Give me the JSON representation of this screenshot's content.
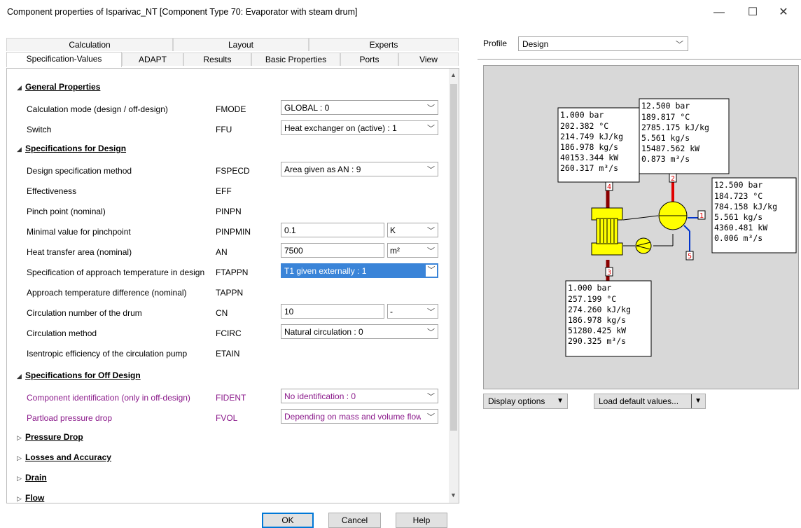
{
  "window": {
    "title": "Component properties of Isparivac_NT   [Component Type 70: Evaporator with steam drum]",
    "minimize": "—",
    "maximize": "☐",
    "close": "✕"
  },
  "tabs_row1": [
    "Calculation",
    "Layout",
    "Experts"
  ],
  "tabs_row2": [
    "Specification-Values",
    "ADAPT",
    "Results",
    "Basic Properties",
    "Ports",
    "View"
  ],
  "sections": {
    "general": "General Properties",
    "design": "Specifications for Design",
    "offdesign": "Specifications for Off Design",
    "pressure_drop": "Pressure Drop",
    "losses": "Losses and Accuracy",
    "drain": "Drain",
    "flow": "Flow"
  },
  "rows": [
    {
      "label": "Calculation mode (design / off-design)",
      "code": "FMODE",
      "value": "GLOBAL : 0"
    },
    {
      "label": "Switch",
      "code": "FFU",
      "value": "Heat exchanger on (active) : 1"
    },
    {
      "label": "Design specification method",
      "code": "FSPECD",
      "value": "Area given as AN : 9"
    },
    {
      "label": "Effectiveness",
      "code": "EFF",
      "value": ""
    },
    {
      "label": "Pinch point (nominal)",
      "code": "PINPN",
      "value": ""
    },
    {
      "label": "Minimal value for pinchpoint",
      "code": "PINPMIN",
      "value": "0.1",
      "unit": "K"
    },
    {
      "label": "Heat transfer area (nominal)",
      "code": "AN",
      "value": "7500",
      "unit": "m²"
    },
    {
      "label": "Specification of approach temperature in design",
      "code": "FTAPPN",
      "value": "T1 given externally : 1"
    },
    {
      "label": "Approach temperature difference (nominal)",
      "code": "TAPPN",
      "value": ""
    },
    {
      "label": "Circulation number of the drum",
      "code": "CN",
      "value": "10",
      "unit": "-"
    },
    {
      "label": "Circulation method",
      "code": "FCIRC",
      "value": "Natural circulation : 0"
    },
    {
      "label": "Isentropic efficiency of the circulation pump",
      "code": "ETAIN",
      "value": ""
    },
    {
      "label": "Component identification (only in off-design)",
      "code": "FIDENT",
      "value": "No identification : 0"
    },
    {
      "label": "Partload pressure drop",
      "code": "FVOL",
      "value": "Depending on mass and volume flow"
    }
  ],
  "buttons": {
    "ok": "OK",
    "cancel": "Cancel",
    "help": "Help"
  },
  "profile": {
    "label": "Profile",
    "value": "Design"
  },
  "bottom": {
    "display_options": "Display options",
    "load_defaults": "Load default values..."
  },
  "diagram": {
    "ports": [
      "1",
      "2",
      "3",
      "4",
      "5"
    ],
    "box4": [
      "1.000 bar",
      "202.382 °C",
      "214.749 kJ/kg",
      "186.978 kg/s",
      "40153.344 kW",
      "260.317 m³/s"
    ],
    "box2": [
      "12.500 bar",
      "189.817 °C",
      "2785.175 kJ/kg",
      "5.561 kg/s",
      "15487.562 kW",
      "0.873 m³/s"
    ],
    "box1": [
      "12.500 bar",
      "184.723 °C",
      "784.158 kJ/kg",
      "5.561 kg/s",
      "4360.481 kW",
      "0.006 m³/s"
    ],
    "box3": [
      "1.000 bar",
      "257.199 °C",
      "274.260 kJ/kg",
      "186.978 kg/s",
      "51280.425 kW",
      "290.325 m³/s"
    ],
    "colors": {
      "background": "#d8d8d8",
      "component": "#ffff00",
      "flue": "#8b0000",
      "steam": "#e00000",
      "water": "#0033cc"
    }
  }
}
